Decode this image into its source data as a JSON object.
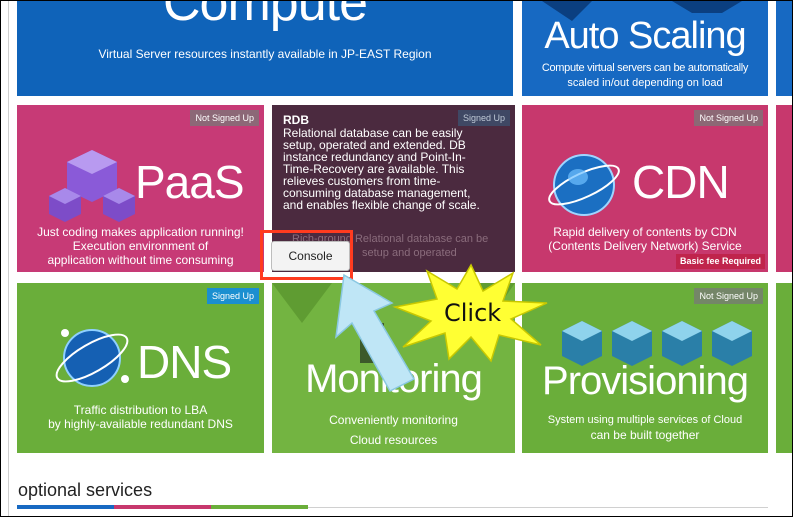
{
  "tiles": {
    "compute": {
      "title": "Compute",
      "desc": "Virtual Server resources instantly available in JP-EAST Region",
      "color": "#0f63b9"
    },
    "autoscaling": {
      "title": "Auto Scaling",
      "desc_line1": "Compute virtual servers can be automatically",
      "desc_line2": "scaled in/out depending on load",
      "color": "#1769c2"
    },
    "paas": {
      "badge": "Not Signed Up",
      "title": "PaaS",
      "desc_line1": "Just coding makes application running!",
      "desc_line2": "Execution environment of",
      "desc_line3": "application without time consuming",
      "color": "#c73a76"
    },
    "rdb": {
      "badge": "Signed Up",
      "heading": "RDB",
      "description": "Relational database can be easily setup, operated and extended. DB instance redundancy and Point-In-Time-Recovery are available. This relieves customers from time-consuming database management, and enables flexible change of scale.",
      "bg_text_line1": "Rich-ground Relational database can be",
      "bg_text_line2": "setup and operated",
      "console_label": "Console",
      "color": "#4b2a3f"
    },
    "cdn": {
      "badge": "Not Signed Up",
      "title": "CDN",
      "desc_line1": "Rapid delivery of contents by CDN",
      "desc_line2": "(Contents Delivery Network) Service",
      "fee": "Basic fee Required",
      "color": "#c7386d"
    },
    "dns": {
      "badge": "Signed Up",
      "title": "DNS",
      "desc_line1": "Traffic distribution to LBA",
      "desc_line2": "by highly-available redundant DNS",
      "color": "#6aae3a"
    },
    "monitoring": {
      "title": "Monitoring",
      "desc_line1": "Conveniently monitoring",
      "desc_line2": "Cloud resources",
      "color": "#73b441"
    },
    "provisioning": {
      "badge": "Not Signed Up",
      "title": "Provisioning",
      "desc_line1": "System using multiple services of Cloud",
      "desc_line2": "can be built together",
      "color": "#6aae3a"
    }
  },
  "callout": {
    "label": "Click"
  },
  "section": {
    "optional_title": "optional services"
  },
  "colors": {
    "highlight": "#ff3b1f",
    "callout_fill": "#ffff33",
    "arrow_fill": "#bfe6f6"
  }
}
